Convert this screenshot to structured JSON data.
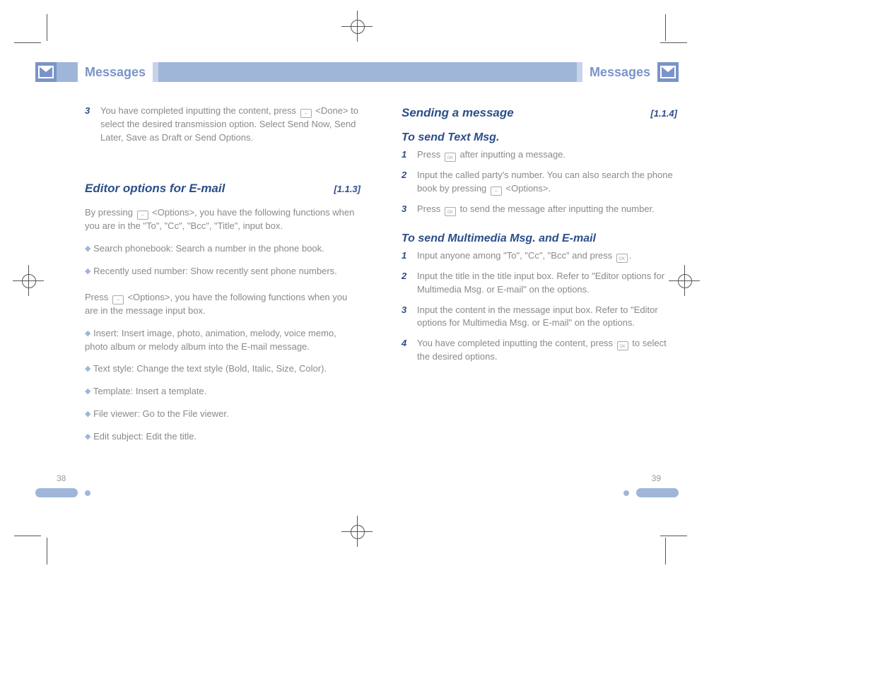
{
  "header": {
    "title": "Messages",
    "icon": "envelope-icon"
  },
  "pages": {
    "left_num": "38",
    "right_num": "39"
  },
  "left": {
    "step3": {
      "n": "3",
      "text_a": "You have completed inputting the content, press ",
      "text_b": " <Done> to select the desired transmission option. Select Send Now, Send Later, Save as Draft or Send Options."
    },
    "section": {
      "title": "Editor options for E-mail",
      "ref": "[1.1.3]"
    },
    "para1_a": "By pressing ",
    "para1_b": " <Options>, you have the following functions when you are in the \"To\", \"Cc\", \"Bcc\", \"Title\", input box.",
    "items1": [
      "Search phonebook: Search a number in the phone book.",
      "Recently used number: Show recently sent phone numbers."
    ],
    "para2_a": "Press ",
    "para2_b": " <Options>, you have the following functions when you are in the message input box.",
    "items2": [
      "Insert: Insert image, photo, animation, melody, voice memo, photo album or melody album into the E-mail message.",
      "Text style: Change the text style (Bold, Italic, Size, Color).",
      "Template: Insert a template.",
      "File viewer: Go to the File viewer.",
      "Edit subject: Edit the title."
    ]
  },
  "right": {
    "section1": {
      "title": "Sending a message",
      "ref": "[1.1.4]"
    },
    "sub1": "To send Text Msg.",
    "r1": {
      "n": "1",
      "a": "Press ",
      "b": " after inputting a message."
    },
    "r2": {
      "n": "2",
      "a": "Input the called party's number. You can also search the phone book by pressing ",
      "b": " <Options>."
    },
    "r3": {
      "n": "3",
      "a": "Press ",
      "b": " to send the message after inputting the number."
    },
    "sub2": "To send Multimedia Msg. and E-mail",
    "m1": {
      "n": "1",
      "a": "Input anyone among \"To\", \"Cc\", \"Bcc\" and press ",
      "b": "."
    },
    "m2": {
      "n": "2",
      "a": "Input the title in the title input box. Refer to \"Editor options for Multimedia Msg. or E-mail\" on the options."
    },
    "m3": {
      "n": "3",
      "a": "Input the content in the message input box. Refer to \"Editor options for Multimedia Msg. or E-mail\" on the options."
    },
    "m4": {
      "n": "4",
      "a": "You have completed inputting the content, press ",
      "b": " to select the desired options."
    }
  }
}
